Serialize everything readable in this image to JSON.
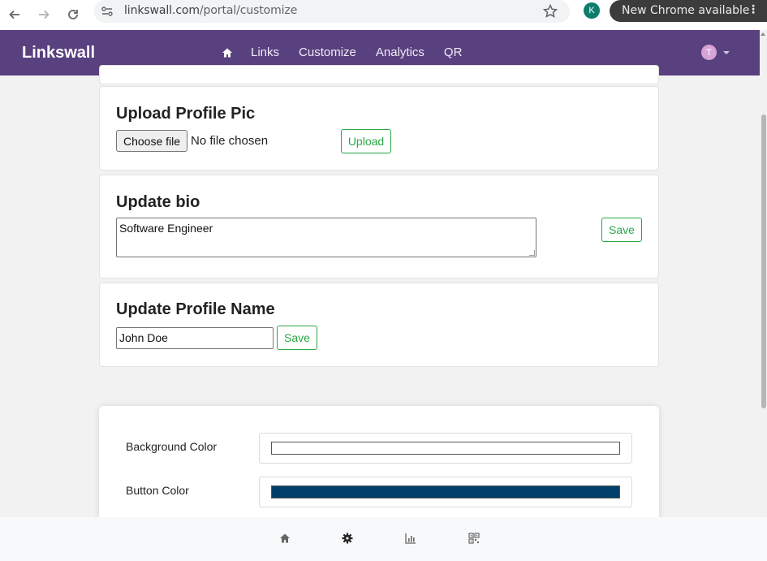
{
  "browser": {
    "url_host": "linkswall.com",
    "url_path": "/portal/customize",
    "profile_initial": "K",
    "update_label": "New Chrome available",
    "menu_glyph": "⋮"
  },
  "navbar": {
    "brand": "Linkswall",
    "links": [
      "Links",
      "Customize",
      "Analytics",
      "QR"
    ],
    "avatar_initial": "T"
  },
  "upload_section": {
    "title": "Upload Profile Pic",
    "choose_label": "Choose file",
    "file_status": "No file chosen",
    "upload_label": "Upload"
  },
  "bio_section": {
    "title": "Update bio",
    "bio_value": "Software Engineer",
    "save_label": "Save"
  },
  "name_section": {
    "title": "Update Profile Name",
    "name_value": "John Doe",
    "save_label": "Save"
  },
  "colors_section": {
    "background_label": "Background Color",
    "background_value": "#ffffff",
    "button_label": "Button Color",
    "button_value": "#003f68"
  },
  "bottom_bar": {
    "icons": [
      "home-icon",
      "gear-icon",
      "bar-chart-icon",
      "qr-code-icon"
    ]
  },
  "colors": {
    "navbar": "#59407f",
    "accent_green": "#28a745"
  }
}
